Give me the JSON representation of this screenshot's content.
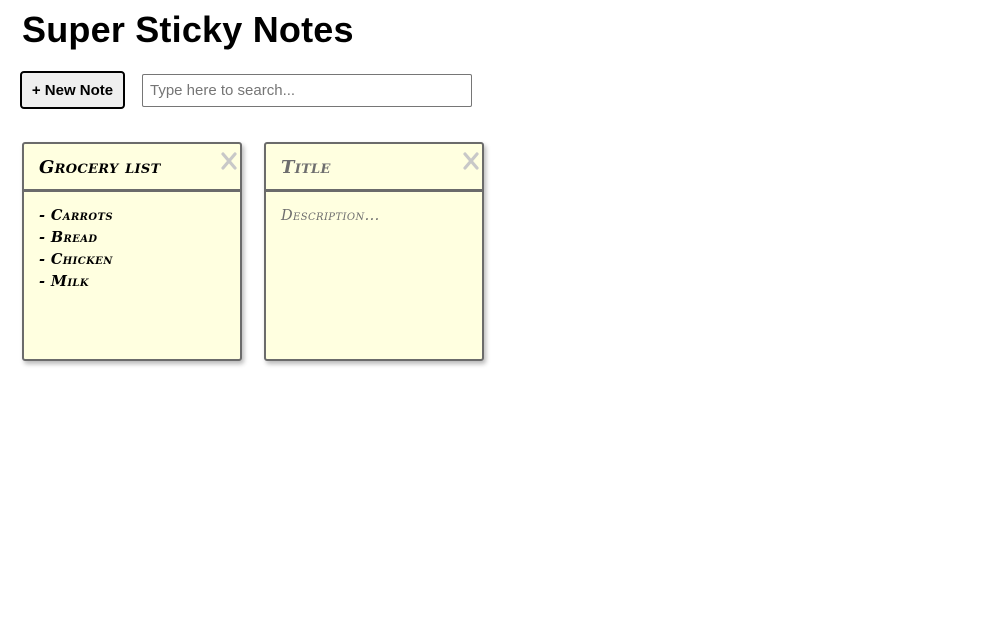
{
  "app": {
    "title": "Super Sticky Notes"
  },
  "toolbar": {
    "new_note_label": "+ New Note",
    "search": {
      "value": "",
      "placeholder": "Type here to search..."
    }
  },
  "notes": [
    {
      "title": "Grocery list",
      "title_is_placeholder": false,
      "lines": [
        "- Carrots",
        "- Bread",
        "- Chicken",
        "- Milk"
      ],
      "close_icon": "close-icon"
    },
    {
      "title": "Title",
      "title_is_placeholder": true,
      "lines": [
        "Description..."
      ],
      "close_icon": "close-icon"
    }
  ],
  "colors": {
    "note_background": "#ffffe0",
    "note_border": "#6b6b6b",
    "close_icon": "#c8c8c8",
    "placeholder_text": "#6e6e6e"
  }
}
